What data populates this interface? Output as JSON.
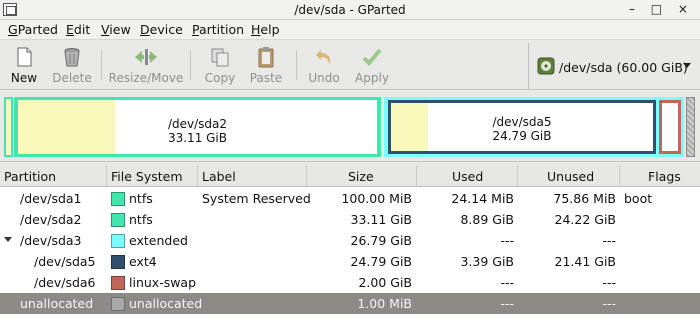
{
  "window": {
    "title": "/dev/sda - GParted",
    "controls": "– □ ×"
  },
  "menu": [
    {
      "mnemonic": "G",
      "rest": "Parted"
    },
    {
      "mnemonic": "E",
      "rest": "dit"
    },
    {
      "mnemonic": "V",
      "rest": "iew"
    },
    {
      "mnemonic": "D",
      "rest": "evice"
    },
    {
      "mnemonic": "P",
      "rest": "artition"
    },
    {
      "mnemonic": "H",
      "rest": "elp"
    }
  ],
  "toolbar": {
    "new": {
      "label": "New",
      "icon": "new-document-icon"
    },
    "delete": {
      "label": "Delete",
      "icon": "trash-icon"
    },
    "resize": {
      "label": "Resize/Move",
      "icon": "resize-arrows-icon"
    },
    "copy": {
      "label": "Copy",
      "icon": "copy-icon"
    },
    "paste": {
      "label": "Paste",
      "icon": "paste-clipboard-icon"
    },
    "undo": {
      "label": "Undo",
      "icon": "undo-arrow-icon"
    },
    "apply": {
      "label": "Apply",
      "icon": "checkmark-icon"
    }
  },
  "device": {
    "label": "/dev/sda  (60.00 GiB)",
    "icon": "harddisk-icon"
  },
  "diskmap": {
    "sda2": {
      "name": "/dev/sda2",
      "size": "33.11 GiB",
      "used_fraction": 0.27
    },
    "sda5": {
      "name": "/dev/sda5",
      "size": "24.79 GiB",
      "used_fraction": 0.14
    }
  },
  "columns": {
    "partition": "Partition",
    "filesystem": "File System",
    "label": "Label",
    "size": "Size",
    "used": "Used",
    "unused": "Unused",
    "flags": "Flags"
  },
  "partitions": [
    {
      "name": "/dev/sda1",
      "fs": "ntfs",
      "fs_color": "#42e5ac",
      "label": "System Reserved",
      "size": "100.00 MiB",
      "used": "24.14 MiB",
      "unused": "75.86 MiB",
      "flags": "boot"
    },
    {
      "name": "/dev/sda2",
      "fs": "ntfs",
      "fs_color": "#42e5ac",
      "label": "",
      "size": "33.11 GiB",
      "used": "8.89 GiB",
      "unused": "24.22 GiB",
      "flags": ""
    },
    {
      "name": "/dev/sda3",
      "fs": "extended",
      "fs_color": "#7dfcfe",
      "label": "",
      "size": "26.79 GiB",
      "used": "---",
      "unused": "---",
      "flags": ""
    },
    {
      "name": "/dev/sda5",
      "fs": "ext4",
      "fs_color": "#314e6c",
      "label": "",
      "size": "24.79 GiB",
      "used": "3.39 GiB",
      "unused": "21.41 GiB",
      "flags": ""
    },
    {
      "name": "/dev/sda6",
      "fs": "linux-swap",
      "fs_color": "#c1665a",
      "label": "",
      "size": "2.00 GiB",
      "used": "---",
      "unused": "---",
      "flags": ""
    },
    {
      "name": "unallocated",
      "fs": "unallocated",
      "fs_color": "#a9a9a9",
      "label": "",
      "size": "1.00 MiB",
      "used": "---",
      "unused": "---",
      "flags": ""
    }
  ],
  "colors": {
    "ntfs": "#42e5ac",
    "extended": "#7dfcfe",
    "ext4": "#314e6c",
    "linux_swap": "#c1665a",
    "used_space": "#f8f8ba",
    "selection": "#8c8a86"
  }
}
